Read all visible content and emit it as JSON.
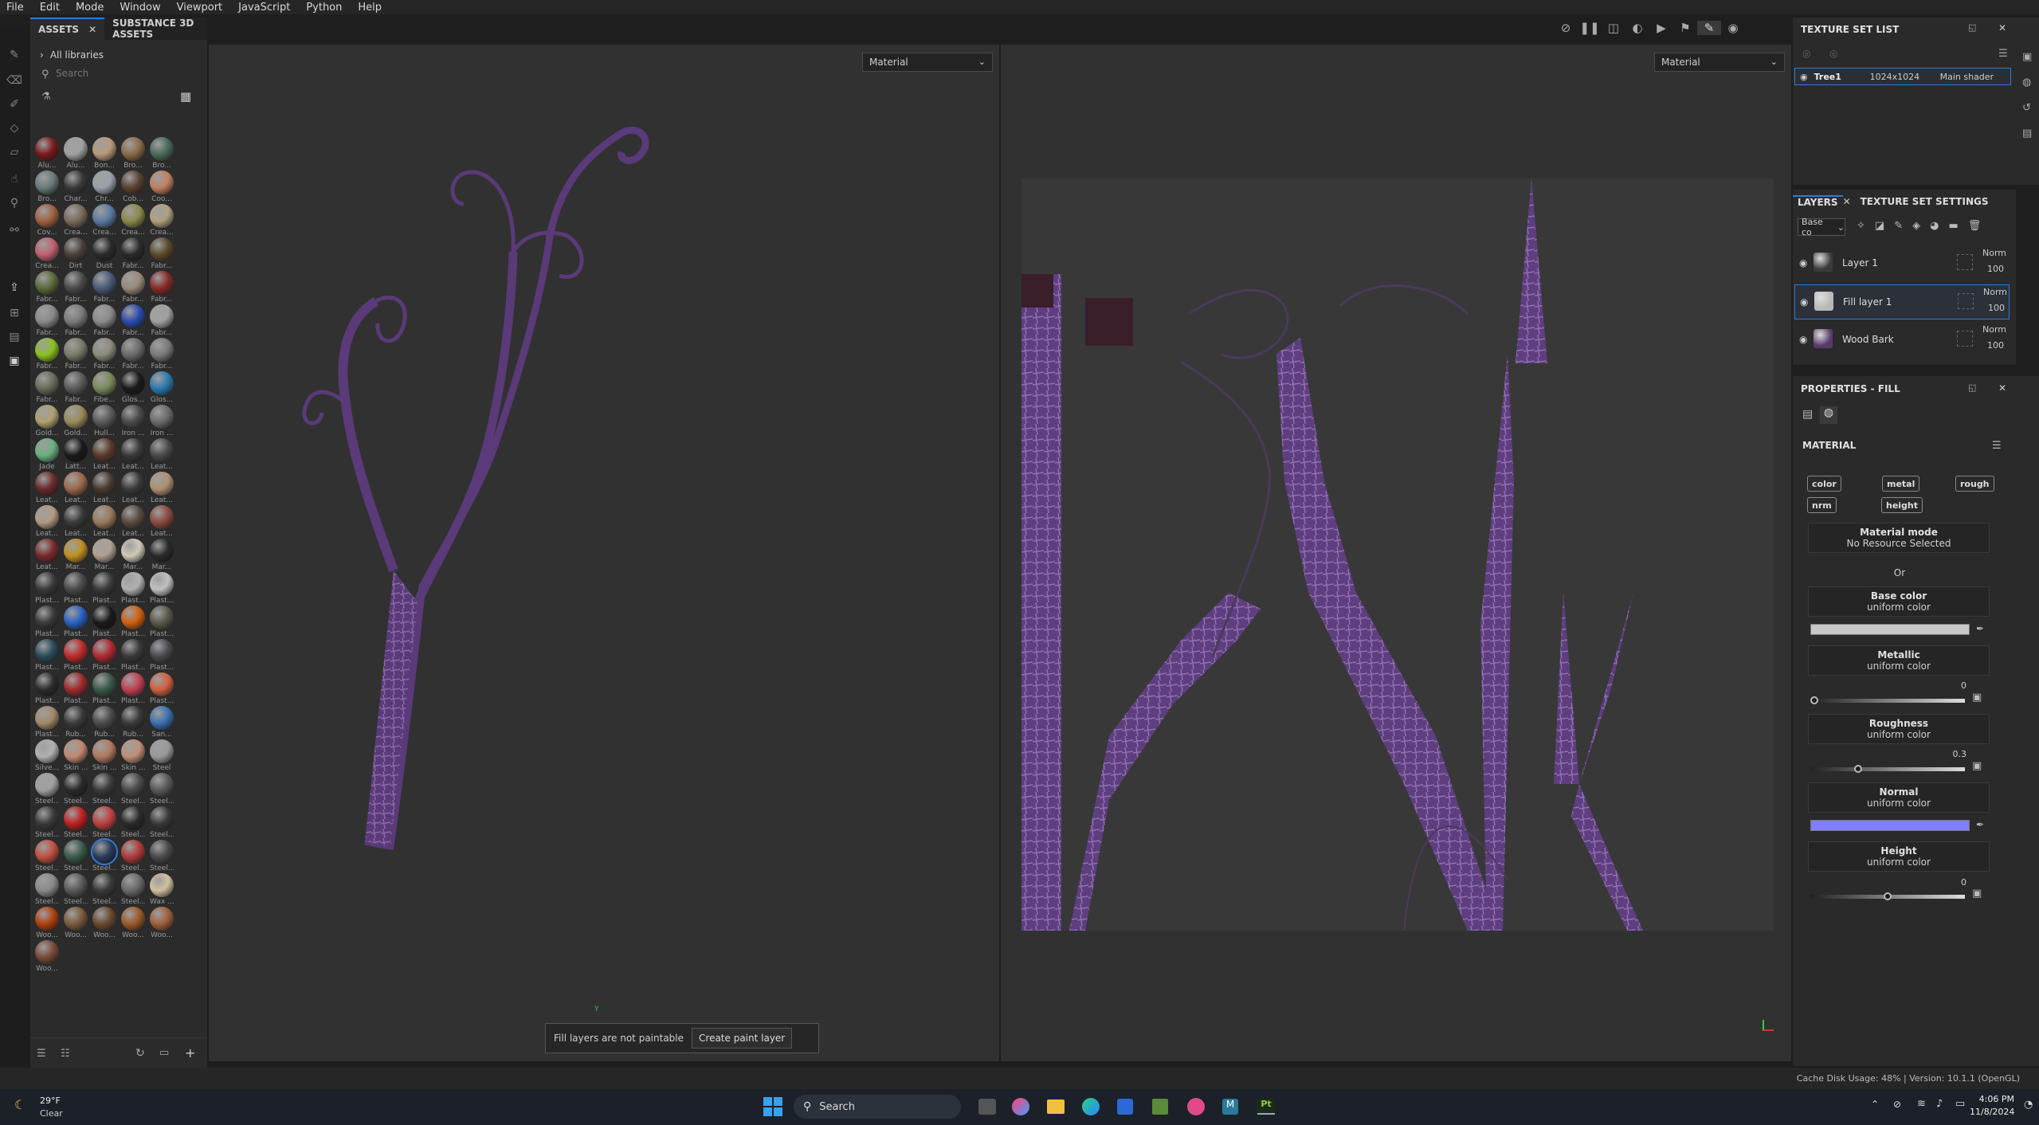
{
  "menu": [
    "File",
    "Edit",
    "Mode",
    "Window",
    "Viewport",
    "JavaScript",
    "Python",
    "Help"
  ],
  "assets": {
    "tabs": [
      "ASSETS",
      "SUBSTANCE 3D ASSETS"
    ],
    "library": "All libraries",
    "search_placeholder": "Search",
    "items": [
      {
        "label": "Alu...",
        "color": "#7a1a1a"
      },
      {
        "label": "Alu...",
        "color": "#a0a0a0"
      },
      {
        "label": "Bon...",
        "color": "#b89a78"
      },
      {
        "label": "Bro...",
        "color": "#8a6a4a"
      },
      {
        "label": "Bro...",
        "color": "#4a6a5a"
      },
      {
        "label": "Bro...",
        "color": "#6a7a7a"
      },
      {
        "label": "Char...",
        "color": "#3a3a3a"
      },
      {
        "label": "Chr...",
        "color": "#9aa0aa"
      },
      {
        "label": "Cob...",
        "color": "#5a4030"
      },
      {
        "label": "Coo...",
        "color": "#c08060"
      },
      {
        "label": "Cov...",
        "color": "#a06040"
      },
      {
        "label": "Crea...",
        "color": "#7a6a5a"
      },
      {
        "label": "Crea...",
        "color": "#5a7aa0"
      },
      {
        "label": "Crea...",
        "color": "#8a8a4a"
      },
      {
        "label": "Crea...",
        "color": "#b0a080"
      },
      {
        "label": "Crea...",
        "color": "#c06070"
      },
      {
        "label": "Dirt",
        "color": "#4a4038"
      },
      {
        "label": "Dust",
        "color": "#2a2a2a"
      },
      {
        "label": "Fabr...",
        "color": "#2a2a2a"
      },
      {
        "label": "Fabr...",
        "color": "#5a4a2a"
      },
      {
        "label": "Fabr...",
        "color": "#5a6a3a"
      },
      {
        "label": "Fabr...",
        "color": "#4a4a4a"
      },
      {
        "label": "Fabr...",
        "color": "#4a5a7a"
      },
      {
        "label": "Fabr...",
        "color": "#9a8a7a"
      },
      {
        "label": "Fabr...",
        "color": "#8a2a2a"
      },
      {
        "label": "Fabr...",
        "color": "#8a8a8a"
      },
      {
        "label": "Fabr...",
        "color": "#7a7a7a"
      },
      {
        "label": "Fabr...",
        "color": "#8a8a8a"
      },
      {
        "label": "Fabr...",
        "color": "#2a4ab0"
      },
      {
        "label": "Fabr...",
        "color": "#a0a0a0"
      },
      {
        "label": "Fabr...",
        "color": "#8ac020"
      },
      {
        "label": "Fabr...",
        "color": "#7a7a6a"
      },
      {
        "label": "Fabr...",
        "color": "#8a8a7a"
      },
      {
        "label": "Fabr...",
        "color": "#6a6a6a"
      },
      {
        "label": "Fabr...",
        "color": "#7a7a7a"
      },
      {
        "label": "Fabr...",
        "color": "#6a6a5a"
      },
      {
        "label": "Fabr...",
        "color": "#5a5a5a"
      },
      {
        "label": "Fibe...",
        "color": "#7a8a5a"
      },
      {
        "label": "Glos...",
        "color": "#1a1a1a"
      },
      {
        "label": "Glos...",
        "color": "#2a7ab0"
      },
      {
        "label": "Gold...",
        "color": "#b0a070"
      },
      {
        "label": "Gold...",
        "color": "#9a8a5a"
      },
      {
        "label": "Hull...",
        "color": "#5a5a5a"
      },
      {
        "label": "Iron ...",
        "color": "#4a4a4a"
      },
      {
        "label": "Iron ...",
        "color": "#6a6a6a"
      },
      {
        "label": "Jade",
        "color": "#6ab080"
      },
      {
        "label": "Latt...",
        "color": "#1a1a1a"
      },
      {
        "label": "Leat...",
        "color": "#5a3a2a"
      },
      {
        "label": "Leat...",
        "color": "#3a3a3a"
      },
      {
        "label": "Leat...",
        "color": "#4a4a4a"
      },
      {
        "label": "Leat...",
        "color": "#6a2a2a"
      },
      {
        "label": "Leat...",
        "color": "#9a6a4a"
      },
      {
        "label": "Leat...",
        "color": "#4a3a30"
      },
      {
        "label": "Leat...",
        "color": "#3a3a3a"
      },
      {
        "label": "Leat...",
        "color": "#b09070"
      },
      {
        "label": "Leat...",
        "color": "#b09a80"
      },
      {
        "label": "Leat...",
        "color": "#3a3a3a"
      },
      {
        "label": "Leat...",
        "color": "#9a7a5a"
      },
      {
        "label": "Leat...",
        "color": "#5a4a40"
      },
      {
        "label": "Leat...",
        "color": "#8a4a40"
      },
      {
        "label": "Leat...",
        "color": "#7a2a2a"
      },
      {
        "label": "Mar...",
        "color": "#c09020"
      },
      {
        "label": "Mar...",
        "color": "#b0a090"
      },
      {
        "label": "Mar...",
        "color": "#d0c8b8"
      },
      {
        "label": "Mar...",
        "color": "#2a2a2a"
      },
      {
        "label": "Plast...",
        "color": "#3a3a3a"
      },
      {
        "label": "Plast...",
        "color": "#4a4a4a"
      },
      {
        "label": "Plast...",
        "color": "#3a3a3a"
      },
      {
        "label": "Plast...",
        "color": "#b0b0b0"
      },
      {
        "label": "Plast...",
        "color": "#c0c0c0"
      },
      {
        "label": "Plast...",
        "color": "#3a3a3a"
      },
      {
        "label": "Plast...",
        "color": "#2a60c0"
      },
      {
        "label": "Plast...",
        "color": "#1a1a1a"
      },
      {
        "label": "Plast...",
        "color": "#d06010"
      },
      {
        "label": "Plast...",
        "color": "#5a5a4a"
      },
      {
        "label": "Plast...",
        "color": "#2a4a5a"
      },
      {
        "label": "Plast...",
        "color": "#c02a2a"
      },
      {
        "label": "Plast...",
        "color": "#b02a30"
      },
      {
        "label": "Plast...",
        "color": "#3a3a3a"
      },
      {
        "label": "Plast...",
        "color": "#4a4a50"
      },
      {
        "label": "Plast...",
        "color": "#2a2a2a"
      },
      {
        "label": "Plast...",
        "color": "#a02a2a"
      },
      {
        "label": "Plast...",
        "color": "#3a5a4a"
      },
      {
        "label": "Plast...",
        "color": "#c04050"
      },
      {
        "label": "Plast...",
        "color": "#d06040"
      },
      {
        "label": "Plast...",
        "color": "#a08a6a"
      },
      {
        "label": "Rub...",
        "color": "#3a3a3a"
      },
      {
        "label": "Rub...",
        "color": "#4a4a4a"
      },
      {
        "label": "Rub...",
        "color": "#3a3a3a"
      },
      {
        "label": "San...",
        "color": "#3a70b0"
      },
      {
        "label": "Silve...",
        "color": "#b0b0b0"
      },
      {
        "label": "Skin ...",
        "color": "#c08870"
      },
      {
        "label": "Skin ...",
        "color": "#b07a60"
      },
      {
        "label": "Skin ...",
        "color": "#c09078"
      },
      {
        "label": "Steel",
        "color": "#9a9a9a"
      },
      {
        "label": "Steel...",
        "color": "#a0a0a0"
      },
      {
        "label": "Steel...",
        "color": "#2a2a2a"
      },
      {
        "label": "Steel...",
        "color": "#3a3a3a"
      },
      {
        "label": "Steel...",
        "color": "#4a4a4a"
      },
      {
        "label": "Steel...",
        "color": "#5a5a5a"
      },
      {
        "label": "Steel...",
        "color": "#3a3a3a"
      },
      {
        "label": "Steel...",
        "color": "#c02020"
      },
      {
        "label": "Steel...",
        "color": "#c04040"
      },
      {
        "label": "Steel...",
        "color": "#2a2a2a"
      },
      {
        "label": "Steel...",
        "color": "#3a3a3a"
      },
      {
        "label": "Steel...",
        "color": "#c05040"
      },
      {
        "label": "Steel...",
        "color": "#3a5a4a"
      },
      {
        "label": "Steel...",
        "color": "#2a3a5a"
      },
      {
        "label": "Steel...",
        "color": "#b03a3a"
      },
      {
        "label": "Steel...",
        "color": "#4a4a4a"
      },
      {
        "label": "Steel...",
        "color": "#8a8a8a"
      },
      {
        "label": "Steel...",
        "color": "#5a5a5a"
      },
      {
        "label": "Steel...",
        "color": "#3a3a3a"
      },
      {
        "label": "Steel...",
        "color": "#6a6a6a"
      },
      {
        "label": "Wax ...",
        "color": "#d0c0a0"
      },
      {
        "label": "Woo...",
        "color": "#b04010"
      },
      {
        "label": "Woo...",
        "color": "#7a5a3a"
      },
      {
        "label": "Woo...",
        "color": "#6a4a30"
      },
      {
        "label": "Woo...",
        "color": "#9a5a2a"
      },
      {
        "label": "Woo...",
        "color": "#a0603a"
      },
      {
        "label": "Woo...",
        "color": "#7a4a3a"
      }
    ],
    "selected_index": 107
  },
  "viewport": {
    "left_mode": "Material",
    "right_mode": "Material",
    "notice": "Fill layers are not paintable",
    "create_button": "Create paint layer",
    "axis_y": "Y"
  },
  "texture_set_list": {
    "title": "TEXTURE SET LIST",
    "row": {
      "name": "Tree1",
      "size": "1024x1024",
      "shader": "Main shader"
    }
  },
  "layers": {
    "tabs": [
      "LAYERS",
      "TEXTURE SET SETTINGS"
    ],
    "channel": "Base co",
    "items": [
      {
        "name": "Layer 1",
        "blend": "Norm",
        "opacity": "100",
        "thumb": "#3a3a3a"
      },
      {
        "name": "Fill layer 1",
        "blend": "Norm",
        "opacity": "100",
        "thumb": "#b8b8b8"
      },
      {
        "name": "Wood Bark",
        "blend": "Norm",
        "opacity": "100",
        "thumb": "#5a3a6a"
      }
    ]
  },
  "properties": {
    "title": "PROPERTIES - FILL",
    "section": "MATERIAL",
    "channels": [
      "color",
      "metal",
      "rough",
      "nrm",
      "height"
    ],
    "material_mode": {
      "title": "Material mode",
      "value": "No Resource Selected"
    },
    "or": "Or",
    "base_color": {
      "title": "Base color",
      "value": "uniform color",
      "swatch": "#c8c8c8"
    },
    "metallic": {
      "title": "Metallic",
      "value": "uniform color",
      "number": "0",
      "level": 0
    },
    "roughness": {
      "title": "Roughness",
      "value": "uniform color",
      "number": "0.3",
      "level": 0.3
    },
    "normal": {
      "title": "Normal",
      "value": "uniform color",
      "swatch": "#7f7fff"
    },
    "height": {
      "title": "Height",
      "value": "uniform color",
      "number": "0",
      "level": 0.5
    }
  },
  "status": {
    "cache": "Cache Disk Usage:   48%  |  Version: 10.1.1 (OpenGL)"
  },
  "taskbar": {
    "temp": "29°F",
    "weather": "Clear",
    "search": "Search",
    "time": "4:06 PM",
    "date": "11/8/2024"
  }
}
